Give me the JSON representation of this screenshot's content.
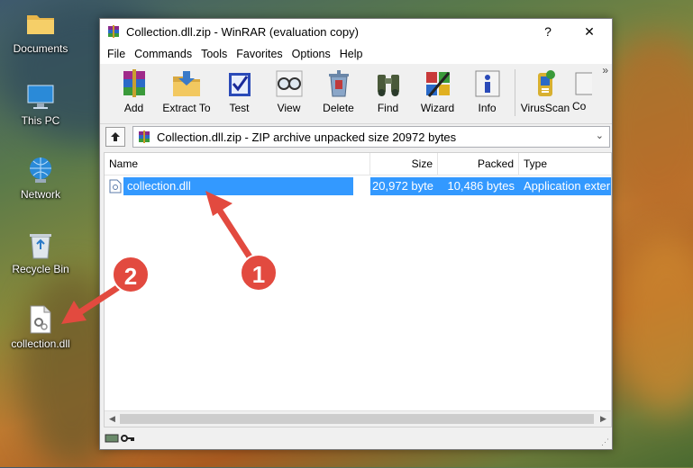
{
  "desktop": {
    "icons": [
      {
        "label": "Documents"
      },
      {
        "label": "This PC"
      },
      {
        "label": "Network"
      },
      {
        "label": "Recycle Bin"
      },
      {
        "label": "collection.dll"
      }
    ]
  },
  "window": {
    "title": "Collection.dll.zip - WinRAR (evaluation copy)",
    "help_glyph": "?",
    "close_glyph": "✕"
  },
  "menu": [
    "File",
    "Commands",
    "Tools",
    "Favorites",
    "Options",
    "Help"
  ],
  "toolbar": {
    "buttons": [
      {
        "label": "Add",
        "icon": "add-archive-icon"
      },
      {
        "label": "Extract To",
        "icon": "extract-folder-icon"
      },
      {
        "label": "Test",
        "icon": "test-checkmark-icon"
      },
      {
        "label": "View",
        "icon": "view-glasses-icon"
      },
      {
        "label": "Delete",
        "icon": "delete-recycle-icon"
      },
      {
        "label": "Find",
        "icon": "find-binoculars-icon"
      },
      {
        "label": "Wizard",
        "icon": "wizard-wand-icon"
      },
      {
        "label": "Info",
        "icon": "info-icon"
      },
      {
        "label": "VirusScan",
        "icon": "virus-scan-icon"
      },
      {
        "label": "Co",
        "icon": "comment-icon"
      }
    ],
    "overflow_glyph": "»"
  },
  "address": {
    "path": "Collection.dll.zip - ZIP archive unpacked size 20972 bytes"
  },
  "columns": {
    "name": "Name",
    "size": "Size",
    "packed": "Packed",
    "type": "Type"
  },
  "files": [
    {
      "name": "collection.dll",
      "size": "20,972 byte",
      "packed": "10,486 bytes",
      "type": "Application exter"
    }
  ],
  "annotations": {
    "badge1": "1",
    "badge2": "2"
  },
  "colors": {
    "selection": "#3399ff",
    "badge": "#e24a3f"
  }
}
